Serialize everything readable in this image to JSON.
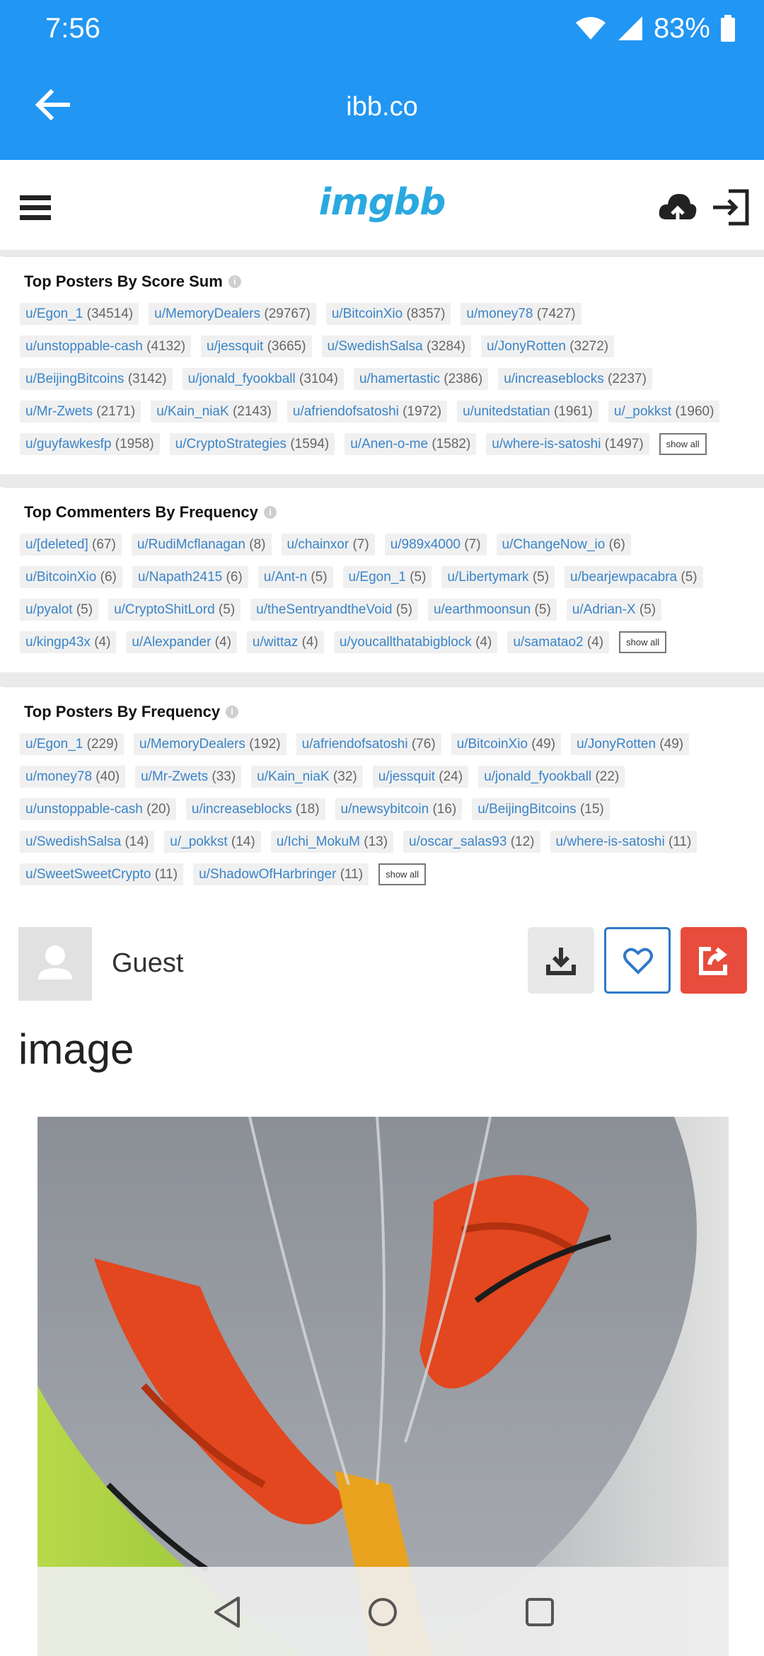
{
  "status_bar": {
    "time": "7:56",
    "battery": "83%"
  },
  "app_bar": {
    "title": "ibb.co"
  },
  "site_header": {
    "logo": "imgbb"
  },
  "sections": [
    {
      "title": "Top Posters By Score Sum",
      "show_all": "show all",
      "rows": [
        [
          {
            "user": "u/Egon_1",
            "count": "(34514)"
          },
          {
            "user": "u/MemoryDealers",
            "count": "(29767)"
          },
          {
            "user": "u/BitcoinXio",
            "count": "(8357)"
          },
          {
            "user": "u/money78",
            "count": "(7427)"
          }
        ],
        [
          {
            "user": "u/unstoppable-cash",
            "count": "(4132)"
          },
          {
            "user": "u/jessquit",
            "count": "(3665)"
          },
          {
            "user": "u/SwedishSalsa",
            "count": "(3284)"
          },
          {
            "user": "u/JonyRotten",
            "count": "(3272)"
          }
        ],
        [
          {
            "user": "u/BeijingBitcoins",
            "count": "(3142)"
          },
          {
            "user": "u/jonald_fyookball",
            "count": "(3104)"
          },
          {
            "user": "u/hamertastic",
            "count": "(2386)"
          },
          {
            "user": "u/increaseblocks",
            "count": "(2237)"
          }
        ],
        [
          {
            "user": "u/Mr-Zwets",
            "count": "(2171)"
          },
          {
            "user": "u/Kain_niaK",
            "count": "(2143)"
          },
          {
            "user": "u/afriendofsatoshi",
            "count": "(1972)"
          },
          {
            "user": "u/unitedstatian",
            "count": "(1961)"
          },
          {
            "user": "u/_pokkst",
            "count": "(1960)"
          }
        ],
        [
          {
            "user": "u/guyfawkesfp",
            "count": "(1958)"
          },
          {
            "user": "u/CryptoStrategies",
            "count": "(1594)"
          },
          {
            "user": "u/Anen-o-me",
            "count": "(1582)"
          },
          {
            "user": "u/where-is-satoshi",
            "count": "(1497)"
          }
        ]
      ]
    },
    {
      "title": "Top Commenters By Frequency",
      "show_all": "show all",
      "rows": [
        [
          {
            "user": "u/[deleted]",
            "count": "(67)"
          },
          {
            "user": "u/RudiMcflanagan",
            "count": "(8)"
          },
          {
            "user": "u/chainxor",
            "count": "(7)"
          },
          {
            "user": "u/989x4000",
            "count": "(7)"
          },
          {
            "user": "u/ChangeNow_io",
            "count": "(6)"
          }
        ],
        [
          {
            "user": "u/BitcoinXio",
            "count": "(6)"
          },
          {
            "user": "u/Napath2415",
            "count": "(6)"
          },
          {
            "user": "u/Ant-n",
            "count": "(5)"
          },
          {
            "user": "u/Egon_1",
            "count": "(5)"
          },
          {
            "user": "u/Libertymark",
            "count": "(5)"
          },
          {
            "user": "u/bearjewpacabra",
            "count": "(5)"
          }
        ],
        [
          {
            "user": "u/pyalot",
            "count": "(5)"
          },
          {
            "user": "u/CryptoShitLord",
            "count": "(5)"
          },
          {
            "user": "u/theSentryandtheVoid",
            "count": "(5)"
          },
          {
            "user": "u/earthmoonsun",
            "count": "(5)"
          },
          {
            "user": "u/Adrian-X",
            "count": "(5)"
          }
        ],
        [
          {
            "user": "u/kingp43x",
            "count": "(4)"
          },
          {
            "user": "u/Alexpander",
            "count": "(4)"
          },
          {
            "user": "u/wittaz",
            "count": "(4)"
          },
          {
            "user": "u/youcallthatabigblock",
            "count": "(4)"
          },
          {
            "user": "u/samatao2",
            "count": "(4)"
          }
        ]
      ]
    },
    {
      "title": "Top Posters By Frequency",
      "show_all": "show all",
      "rows": [
        [
          {
            "user": "u/Egon_1",
            "count": "(229)"
          },
          {
            "user": "u/MemoryDealers",
            "count": "(192)"
          },
          {
            "user": "u/afriendofsatoshi",
            "count": "(76)"
          },
          {
            "user": "u/BitcoinXio",
            "count": "(49)"
          },
          {
            "user": "u/JonyRotten",
            "count": "(49)"
          }
        ],
        [
          {
            "user": "u/money78",
            "count": "(40)"
          },
          {
            "user": "u/Mr-Zwets",
            "count": "(33)"
          },
          {
            "user": "u/Kain_niaK",
            "count": "(32)"
          },
          {
            "user": "u/jessquit",
            "count": "(24)"
          },
          {
            "user": "u/jonald_fyookball",
            "count": "(22)"
          }
        ],
        [
          {
            "user": "u/unstoppable-cash",
            "count": "(20)"
          },
          {
            "user": "u/increaseblocks",
            "count": "(18)"
          },
          {
            "user": "u/newsybitcoin",
            "count": "(16)"
          },
          {
            "user": "u/BeijingBitcoins",
            "count": "(15)"
          }
        ],
        [
          {
            "user": "u/SwedishSalsa",
            "count": "(14)"
          },
          {
            "user": "u/_pokkst",
            "count": "(14)"
          },
          {
            "user": "u/Ichi_MokuM",
            "count": "(13)"
          },
          {
            "user": "u/oscar_salas93",
            "count": "(12)"
          },
          {
            "user": "u/where-is-satoshi",
            "count": "(11)"
          }
        ],
        [
          {
            "user": "u/SweetSweetCrypto",
            "count": "(11)"
          },
          {
            "user": "u/ShadowOfHarbringer",
            "count": "(11)"
          }
        ]
      ]
    }
  ],
  "guest": {
    "name": "Guest"
  },
  "image": {
    "title": "image"
  },
  "colors": {
    "app_bar": "#2196f3",
    "link": "#3a84c8",
    "share_button": "#e74c3c",
    "like_border": "#2e79c7",
    "logo": "#2aa9e0"
  },
  "icons": [
    "back-arrow-icon",
    "hamburger-menu-icon",
    "cloud-upload-icon",
    "sign-in-icon",
    "download-icon",
    "heart-icon",
    "share-icon",
    "wifi-icon",
    "signal-icon",
    "battery-icon",
    "nav-back-icon",
    "nav-home-icon",
    "nav-recents-icon"
  ]
}
